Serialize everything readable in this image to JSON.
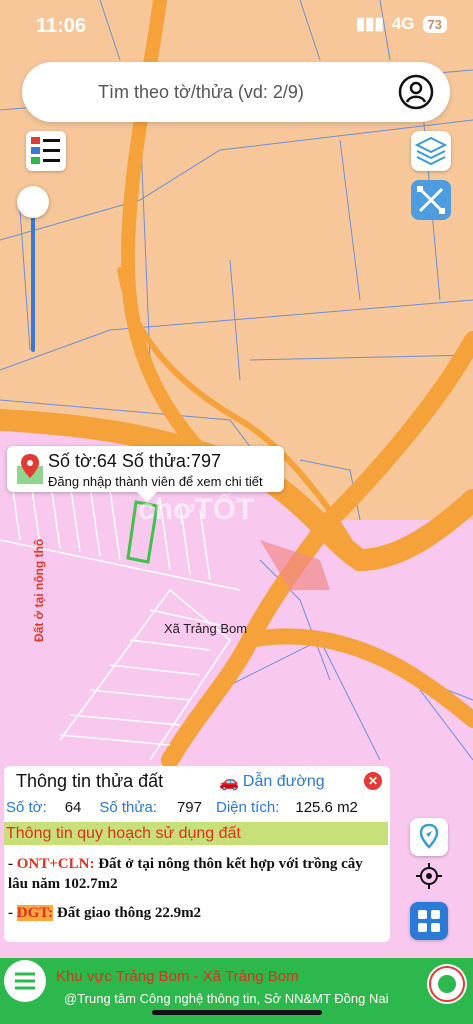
{
  "status_bar": {
    "time": "11:06",
    "network": "4G",
    "battery": "73"
  },
  "search": {
    "placeholder": "Tìm theo tờ/thửa (vd: 2/9)"
  },
  "popup": {
    "title": "Số tờ:64 Số thửa:797",
    "subtitle": "Đăng nhập thành viên để xem chi tiết"
  },
  "map_labels": {
    "commune": "Xã Trảng Bom",
    "vertical_label": "Đất ở tại nông thô",
    "watermark": "chợTỐT"
  },
  "info_panel": {
    "title": "Thông tin thửa đất",
    "directions_label": "Dẫn đường",
    "sheet_label": "Số tờ:",
    "sheet_value": "64",
    "parcel_label": "Số thửa:",
    "parcel_value": "797",
    "area_label": "Diện tích:",
    "area_value": "125.6 m2",
    "plan_header": "Thông tin quy hoạch sử dụng đất",
    "zones": [
      {
        "code": "ONT+CLN:",
        "description": "Đất ở tại nông thôn kết hợp với trồng cây lâu năm 102.7m2"
      },
      {
        "code": "DGT:",
        "description": "Đất giao thông 22.9m2"
      }
    ]
  },
  "bottom_bar": {
    "area": "Khu vực Trảng Bom - Xã Trảng Bom",
    "credit": "@Trung tâm Công nghệ thông tin, Sở NN&MT Đồng Nai"
  },
  "colors": {
    "residential_zone": "#f7c79a",
    "pink_zone": "#f8c8ee",
    "road": "#f5a23a",
    "selected_parcel": "#3fc24a",
    "bottom_bar": "#2cb84c",
    "accent_blue": "#2a7ad6"
  }
}
